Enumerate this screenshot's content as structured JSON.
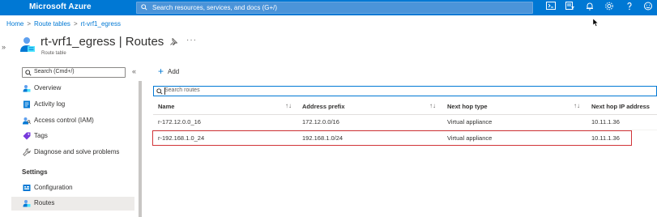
{
  "topbar": {
    "brand": "Microsoft Azure",
    "search_placeholder": "Search resources, services, and docs (G+/)",
    "icons": [
      "cloud-shell-icon",
      "directory-filter-icon",
      "notifications-icon",
      "settings-icon",
      "help-icon",
      "feedback-icon"
    ],
    "accent_color": "#0078d4"
  },
  "breadcrumb": {
    "items": [
      "Home",
      "Route tables",
      "rt-vrf1_egress"
    ]
  },
  "header": {
    "title": "rt-vrf1_egress | Routes",
    "subtitle": "Route table",
    "more": "···"
  },
  "sidebar": {
    "search_placeholder": "Search (Cmd+/)",
    "collapse": "«",
    "items": [
      {
        "label": "Overview",
        "icon": "route-table-icon"
      },
      {
        "label": "Activity log",
        "icon": "activity-log-icon"
      },
      {
        "label": "Access control (IAM)",
        "icon": "iam-icon"
      },
      {
        "label": "Tags",
        "icon": "tag-icon"
      },
      {
        "label": "Diagnose and solve problems",
        "icon": "wrench-icon"
      }
    ],
    "settings_label": "Settings",
    "settings_items": [
      {
        "label": "Configuration",
        "icon": "configuration-icon"
      },
      {
        "label": "Routes",
        "icon": "routes-icon",
        "selected": true
      }
    ]
  },
  "main": {
    "add_label": "Add",
    "search_placeholder": "Search routes",
    "columns": [
      "Name",
      "Address prefix",
      "Next hop type",
      "Next hop IP address"
    ],
    "rows": [
      {
        "name": "r-172.12.0.0_16",
        "prefix": "172.12.0.0/16",
        "hop_type": "Virtual appliance",
        "hop_ip": "10.11.1.36"
      },
      {
        "name": "r-192.168.1.0_24",
        "prefix": "192.168.1.0/24",
        "hop_type": "Virtual appliance",
        "hop_ip": "10.11.1.36",
        "highlighted": true
      }
    ],
    "highlight_color": "#d13438"
  }
}
